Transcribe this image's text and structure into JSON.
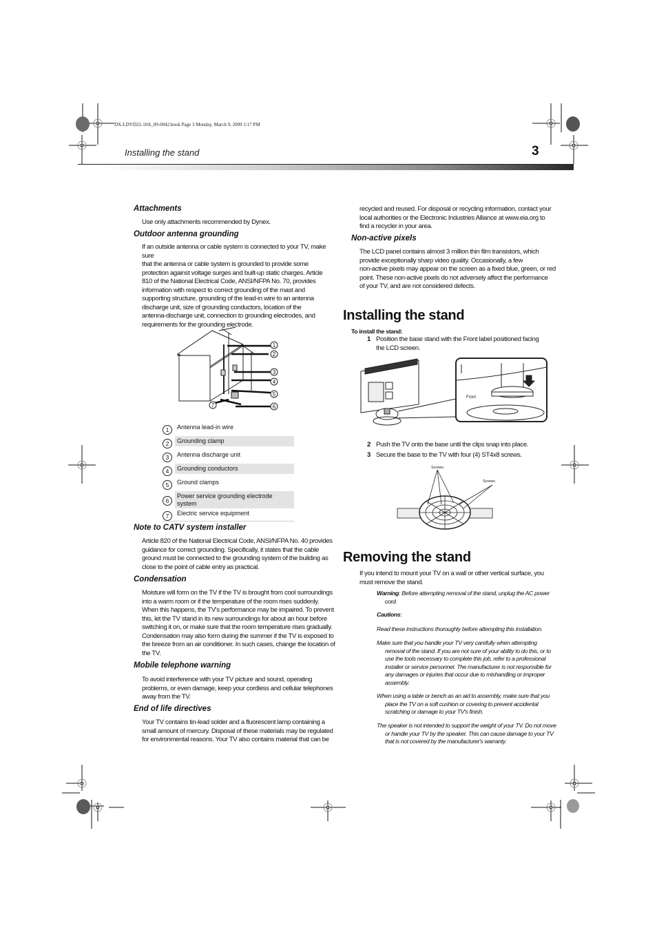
{
  "slug": "DX-LDVD22-10A_09-0042.book  Page 3  Monday, March 9, 2009  1:17 PM",
  "header": {
    "running_head": "Installing the stand",
    "page_number": "3"
  },
  "left_column": {
    "attachments": {
      "title": "Attachments",
      "body": "Use only attachments recommended by Dynex."
    },
    "outdoor_antenna": {
      "title": "Outdoor antenna grounding",
      "lines": [
        "If an outside antenna or cable system is connected to your TV, make sure",
        "that the antenna or cable system is grounded to provide some",
        "protection against voltage surges and built-up static charges. Article",
        "810 of the National Electrical Code, ANSI/NFPA No. 70, provides",
        "information with respect to correct grounding of the mast and",
        "supporting structure, grounding of the lead-in wire to an antenna",
        "discharge unit, size of grounding conductors, location of the",
        "antenna-discharge unit, connection to grounding electrodes, and",
        "requirements for the grounding electrode."
      ]
    },
    "diagram_callouts": [
      "1",
      "2",
      "3",
      "4",
      "5",
      "6",
      "7"
    ],
    "legend": [
      {
        "num": "1",
        "label": "Antenna lead-in wire"
      },
      {
        "num": "2",
        "label": "Grounding clamp"
      },
      {
        "num": "3",
        "label": "Antenna discharge unit"
      },
      {
        "num": "4",
        "label": "Grounding conductors"
      },
      {
        "num": "5",
        "label": "Ground clamps"
      },
      {
        "num": "6",
        "label": "Power service grounding electrode system"
      },
      {
        "num": "7",
        "label": "Electric service equipment"
      }
    ],
    "catv": {
      "title": "Note to CATV system installer",
      "lines": [
        "Article 820 of the National Electrical Code, ANSI/NFPA No. 40 provides",
        "guidance for correct grounding. Specifically, it states that the cable",
        "ground must be connected to the grounding system of the building as",
        "close to the point of cable entry as practical."
      ]
    },
    "condensation": {
      "title": "Condensation",
      "lines": [
        "Moisture will form on the TV if the TV is brought from cool surroundings",
        "into a warm room or if the temperature of the room rises suddenly.",
        "When this happens, the TV's performance may be impaired. To prevent",
        "this, let the TV stand in its new surroundings for about an hour before",
        "switching it on, or make sure that the room temperature rises gradually.",
        "Condensation may also form during the summer if the TV is exposed to",
        "the breeze from an air conditioner. In such cases, change the location of",
        "the TV."
      ]
    },
    "mobile": {
      "title": "Mobile telephone warning",
      "lines": [
        "To avoid interference with your TV picture and sound, operating",
        "problems, or even damage, keep your cordless and cellular telephones",
        "away from the TV."
      ]
    },
    "end_of_life": {
      "title": "End of life directives",
      "lines": [
        "Your TV contains tin-lead solder and a fluorescent lamp containing a",
        "small amount of mercury. Disposal of these materials may be regulated",
        "for environmental reasons. Your TV also contains material that can be"
      ]
    }
  },
  "right_column": {
    "continued_lines": [
      "recycled and reused. For disposal or recycling information, contact your",
      "local authorities or the Electronic Industries Alliance at www.eia.org to",
      "find a recycler in your area."
    ],
    "non_active": {
      "title": "Non-active pixels",
      "lines": [
        "The LCD panel contains almost 3 million thin film transistors, which",
        "provide exceptionally sharp video quality. Occasionally, a few",
        "non-active pixels may appear on the screen as a fixed blue, green, or red",
        "point. These non-active pixels do not adversely affect the performance",
        "of your TV, and are not considered defects."
      ]
    },
    "installing": {
      "title": "Installing the stand",
      "procedure_label": "To install the stand:",
      "steps": [
        {
          "num": "1",
          "text": "Position the base stand with the Front label positioned facing the LCD screen."
        },
        {
          "num": "2",
          "text": "Push the TV onto the base until the clips snap into place."
        },
        {
          "num": "3",
          "text": "Secure the base to the TV with four (4) ST4x8 screws."
        }
      ],
      "figure1_label": "Front",
      "figure2_labels": [
        "Screws",
        "Screws"
      ]
    },
    "removing": {
      "title": "Removing the stand",
      "intro_lines": [
        "If you intend to mount your TV on a wall or other vertical surface, you",
        "must remove the stand."
      ],
      "warning_label": "Warning",
      "warning_text": ": Before attempting removal of the stand, unplug the AC power cord.",
      "cautions_label": "Cautions",
      "cautions_suffix": ":",
      "cautions": [
        "Read these instructions thoroughly before attempting this installation.",
        "Make sure that you handle your TV very carefully when attempting removal of the stand. If you are not sure of your ability to do this, or to use the tools necessary to complete this job, refer to a professional installer or service personnel. The manufacturer is not responsible for any damages or injuries that occur due to mishandling or improper assembly.",
        "When using a table or bench as an aid to assembly, make sure that you place the TV on a soft cushion or covering to prevent accidental scratching or damage to your TV's finish.",
        "The speaker is not intended to support the weight of your TV. Do not move or handle your TV by the speaker. This can cause damage to your TV that is not covered by the manufacturer's warranty."
      ]
    }
  }
}
